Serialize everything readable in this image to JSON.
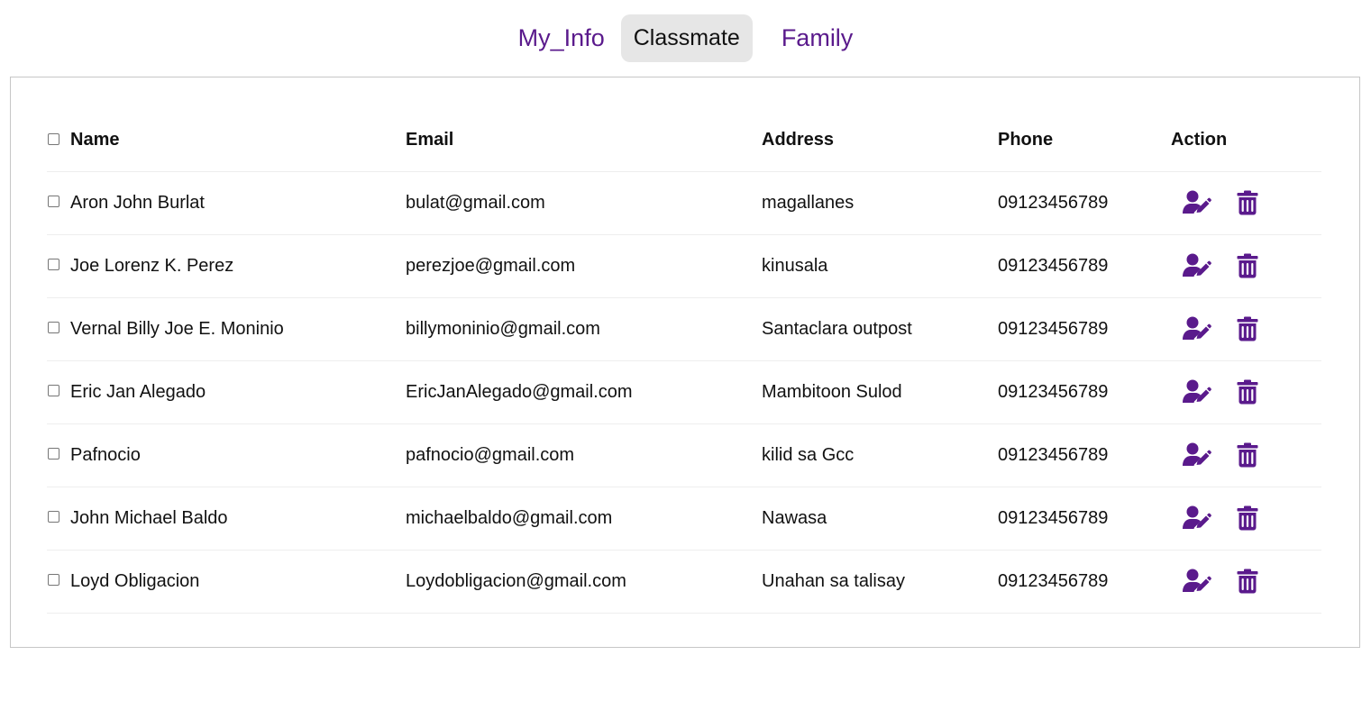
{
  "nav": {
    "tabs": [
      {
        "label": "My_Info",
        "active": false
      },
      {
        "label": "Classmate",
        "active": true
      },
      {
        "label": "Family",
        "active": false
      }
    ]
  },
  "table": {
    "headers": {
      "name": "Name",
      "email": "Email",
      "address": "Address",
      "phone": "Phone",
      "action": "Action"
    },
    "rows": [
      {
        "name": "Aron John Burlat",
        "email": "bulat@gmail.com",
        "address": "magallanes",
        "phone": "09123456789"
      },
      {
        "name": "Joe Lorenz K. Perez",
        "email": "perezjoe@gmail.com",
        "address": "kinusala",
        "phone": "09123456789"
      },
      {
        "name": "Vernal Billy Joe E. Moninio",
        "email": "billymoninio@gmail.com",
        "address": "Santaclara outpost",
        "phone": "09123456789"
      },
      {
        "name": "Eric Jan Alegado",
        "email": "EricJanAlegado@gmail.com",
        "address": "Mambitoon Sulod",
        "phone": "09123456789"
      },
      {
        "name": "Pafnocio",
        "email": "pafnocio@gmail.com",
        "address": "kilid sa Gcc",
        "phone": "09123456789"
      },
      {
        "name": "John Michael Baldo",
        "email": "michaelbaldo@gmail.com",
        "address": "Nawasa",
        "phone": "09123456789"
      },
      {
        "name": "Loyd Obligacion",
        "email": "Loydobligacion@gmail.com",
        "address": "Unahan sa talisay",
        "phone": "09123456789"
      }
    ],
    "row_actions": {
      "edit_icon": "user-edit-icon",
      "delete_icon": "trash-icon"
    }
  },
  "colors": {
    "accent": "#5a1a8c",
    "active_tab_bg": "#e6e6e6",
    "border": "#c6c6c6",
    "row_divider": "#eeeeee"
  }
}
